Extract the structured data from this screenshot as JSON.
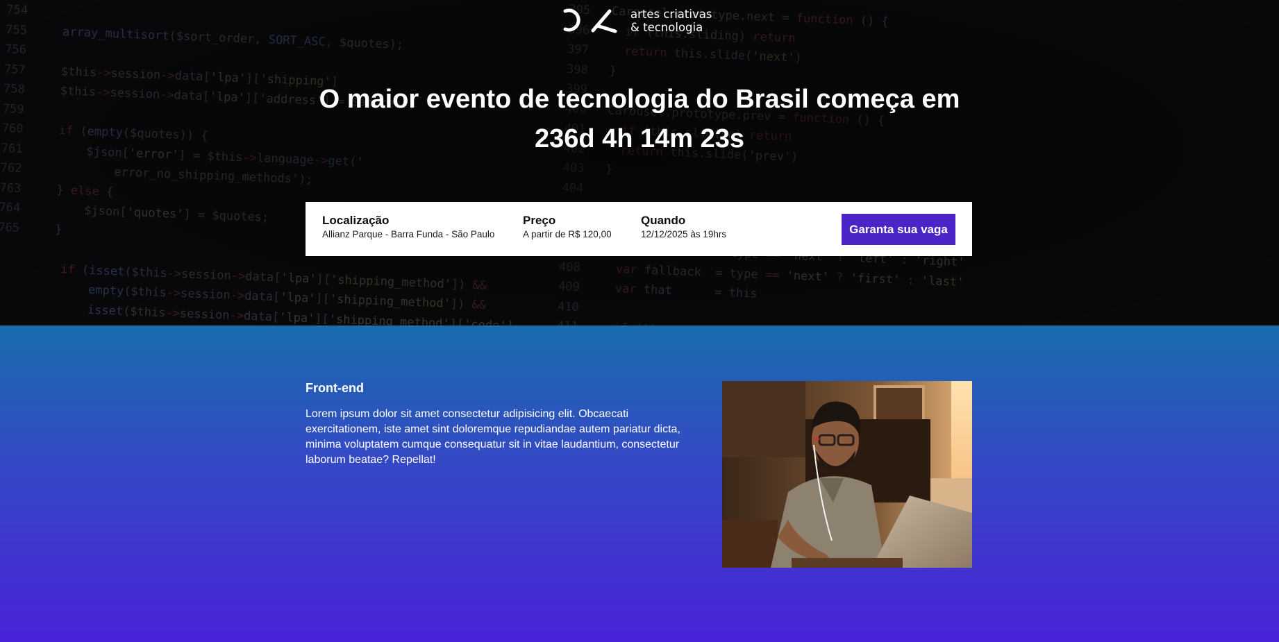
{
  "brand": {
    "name_line1": "artes criativas",
    "name_line2": "& tecnologia"
  },
  "hero": {
    "headline_line1": "O maior evento de tecnologia do Brasil começa em",
    "countdown": "236d 4h 14m 23s"
  },
  "info_bar": {
    "location_title": "Localização",
    "location_value": "Allianz Parque - Barra Funda - São Paulo",
    "price_title": "Preço",
    "price_value": "A partir de R$ 120,00",
    "when_title": "Quando",
    "when_value": "12/12/2025 às 19hrs",
    "cta_label": "Garanta sua vaga"
  },
  "section": {
    "title": "Front-end",
    "text": "Lorem ipsum dolor sit amet consectetur adipisicing elit. Obcaecati exercitationem, iste amet sint doloremque repudiandae autem pariatur dicta, minima voluptatem cumque consequatur sit in vitae laudantium, consectetur laborum beatae? Repellat!"
  },
  "colors": {
    "hero_bg": "#0b0b0d",
    "cta_bg": "#4b25c8",
    "gradient_top": "#1a6dad",
    "gradient_bottom": "#4a22d8"
  }
}
